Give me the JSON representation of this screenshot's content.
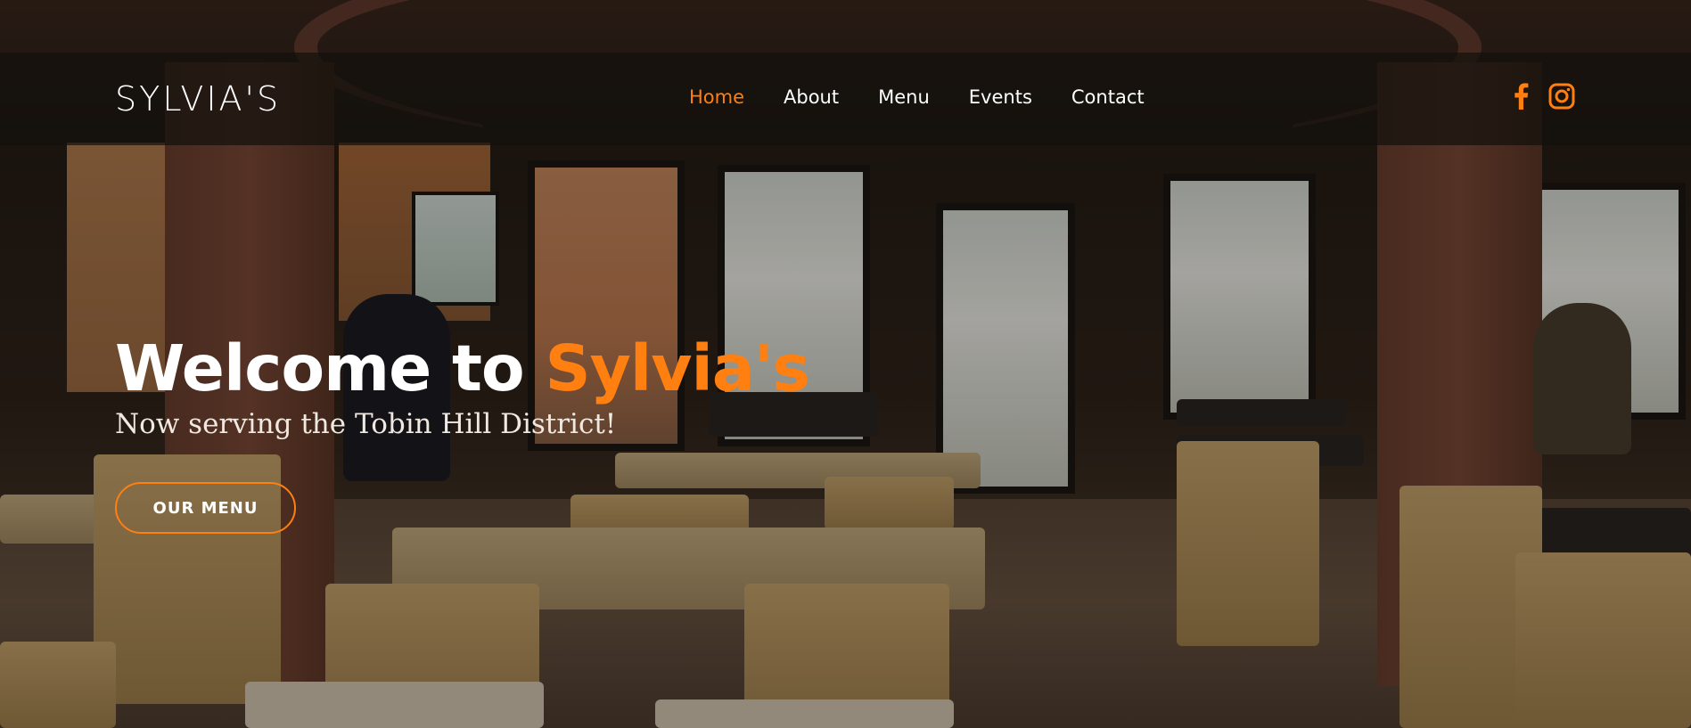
{
  "brand": {
    "logo_text": "SYLVIA'S"
  },
  "nav": {
    "items": [
      {
        "label": "Home",
        "active": true
      },
      {
        "label": "About",
        "active": false
      },
      {
        "label": "Menu",
        "active": false
      },
      {
        "label": "Events",
        "active": false
      },
      {
        "label": "Contact",
        "active": false
      }
    ]
  },
  "social": {
    "icons": [
      "facebook-icon",
      "instagram-icon"
    ]
  },
  "hero": {
    "title_prefix": "Welcome to ",
    "title_accent": "Sylvia's",
    "subtitle": "Now serving the Tobin Hill District!",
    "cta_label": "OUR MENU"
  },
  "colors": {
    "accent": "#ff7f11",
    "text": "#ffffff",
    "navbar_bg": "rgba(20,16,12,0.72)"
  }
}
